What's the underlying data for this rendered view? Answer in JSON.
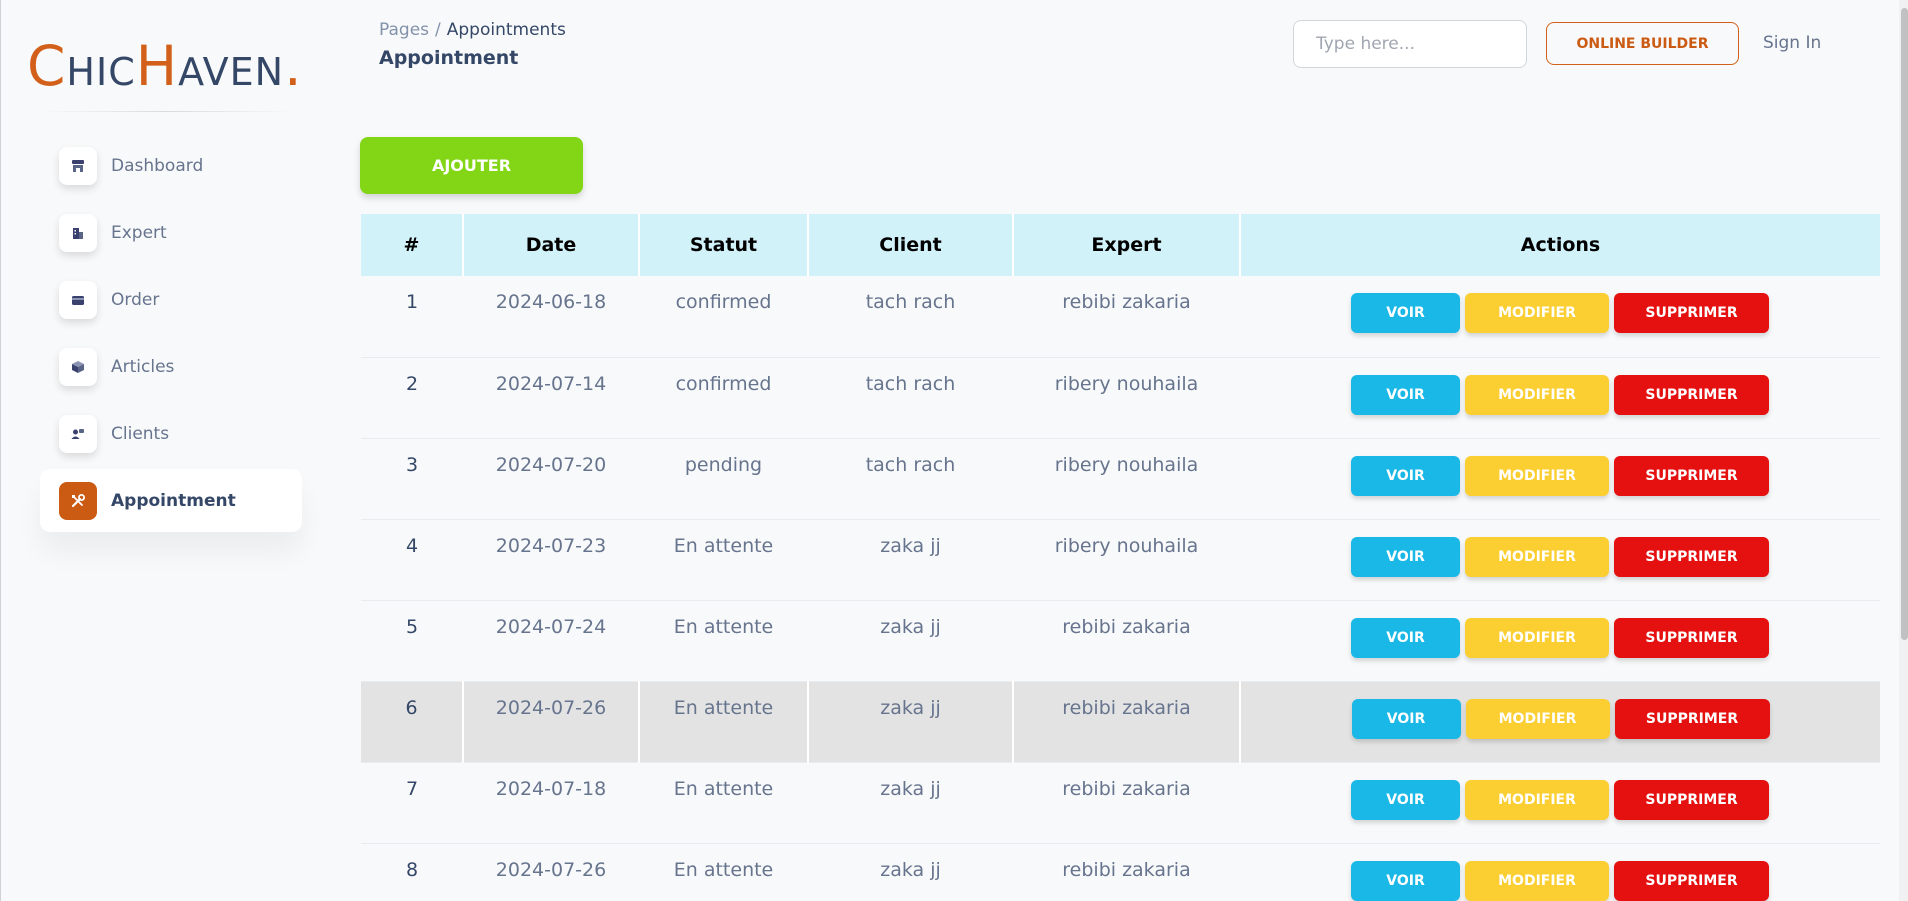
{
  "logo": {
    "c": "C",
    "hic": "HIC",
    "h": "H",
    "aven": "AVEN",
    "dot": "."
  },
  "sidebar": {
    "items": [
      {
        "label": "Dashboard",
        "icon": "shop-icon",
        "active": false
      },
      {
        "label": "Expert",
        "icon": "office-icon",
        "active": false
      },
      {
        "label": "Order",
        "icon": "credit-card-icon",
        "active": false
      },
      {
        "label": "Articles",
        "icon": "box-3d-icon",
        "active": false
      },
      {
        "label": "Clients",
        "icon": "customer-support-icon",
        "active": false
      },
      {
        "label": "Appointment",
        "icon": "settings-tools-icon",
        "active": true
      }
    ]
  },
  "header": {
    "breadcrumb_root": "Pages",
    "breadcrumb_sep": "/",
    "breadcrumb_current": "Appointments",
    "title": "Appointment",
    "search_placeholder": "Type here...",
    "builder_label": "ONLINE BUILDER",
    "signin_label": "Sign In"
  },
  "add_button": "AJOUTER",
  "table": {
    "columns": [
      "#",
      "Date",
      "Statut",
      "Client",
      "Expert",
      "Actions"
    ],
    "rows": [
      {
        "id": "1",
        "date": "2024-06-18",
        "status": "confirmed",
        "client": "tach rach",
        "expert": "rebibi zakaria"
      },
      {
        "id": "2",
        "date": "2024-07-14",
        "status": "confirmed",
        "client": "tach rach",
        "expert": "ribery nouhaila"
      },
      {
        "id": "3",
        "date": "2024-07-20",
        "status": "pending",
        "client": "tach rach",
        "expert": "ribery nouhaila"
      },
      {
        "id": "4",
        "date": "2024-07-23",
        "status": "En attente",
        "client": "zaka jj",
        "expert": "ribery nouhaila"
      },
      {
        "id": "5",
        "date": "2024-07-24",
        "status": "En attente",
        "client": "zaka jj",
        "expert": "rebibi zakaria"
      },
      {
        "id": "6",
        "date": "2024-07-26",
        "status": "En attente",
        "client": "zaka jj",
        "expert": "rebibi zakaria",
        "highlight": true
      },
      {
        "id": "7",
        "date": "2024-07-18",
        "status": "En attente",
        "client": "zaka jj",
        "expert": "rebibi zakaria"
      },
      {
        "id": "8",
        "date": "2024-07-26",
        "status": "En attente",
        "client": "zaka jj",
        "expert": "rebibi zakaria"
      }
    ],
    "actions": {
      "view": "VOIR",
      "edit": "MODIFIER",
      "delete": "SUPPRIMER"
    }
  },
  "colors": {
    "accent": "#cb5a12",
    "add_green": "#82d616",
    "header_bg": "#d1f2f8",
    "voir": "#1ab8e6",
    "modifier": "#fbce32",
    "supprimer": "#e51010"
  }
}
